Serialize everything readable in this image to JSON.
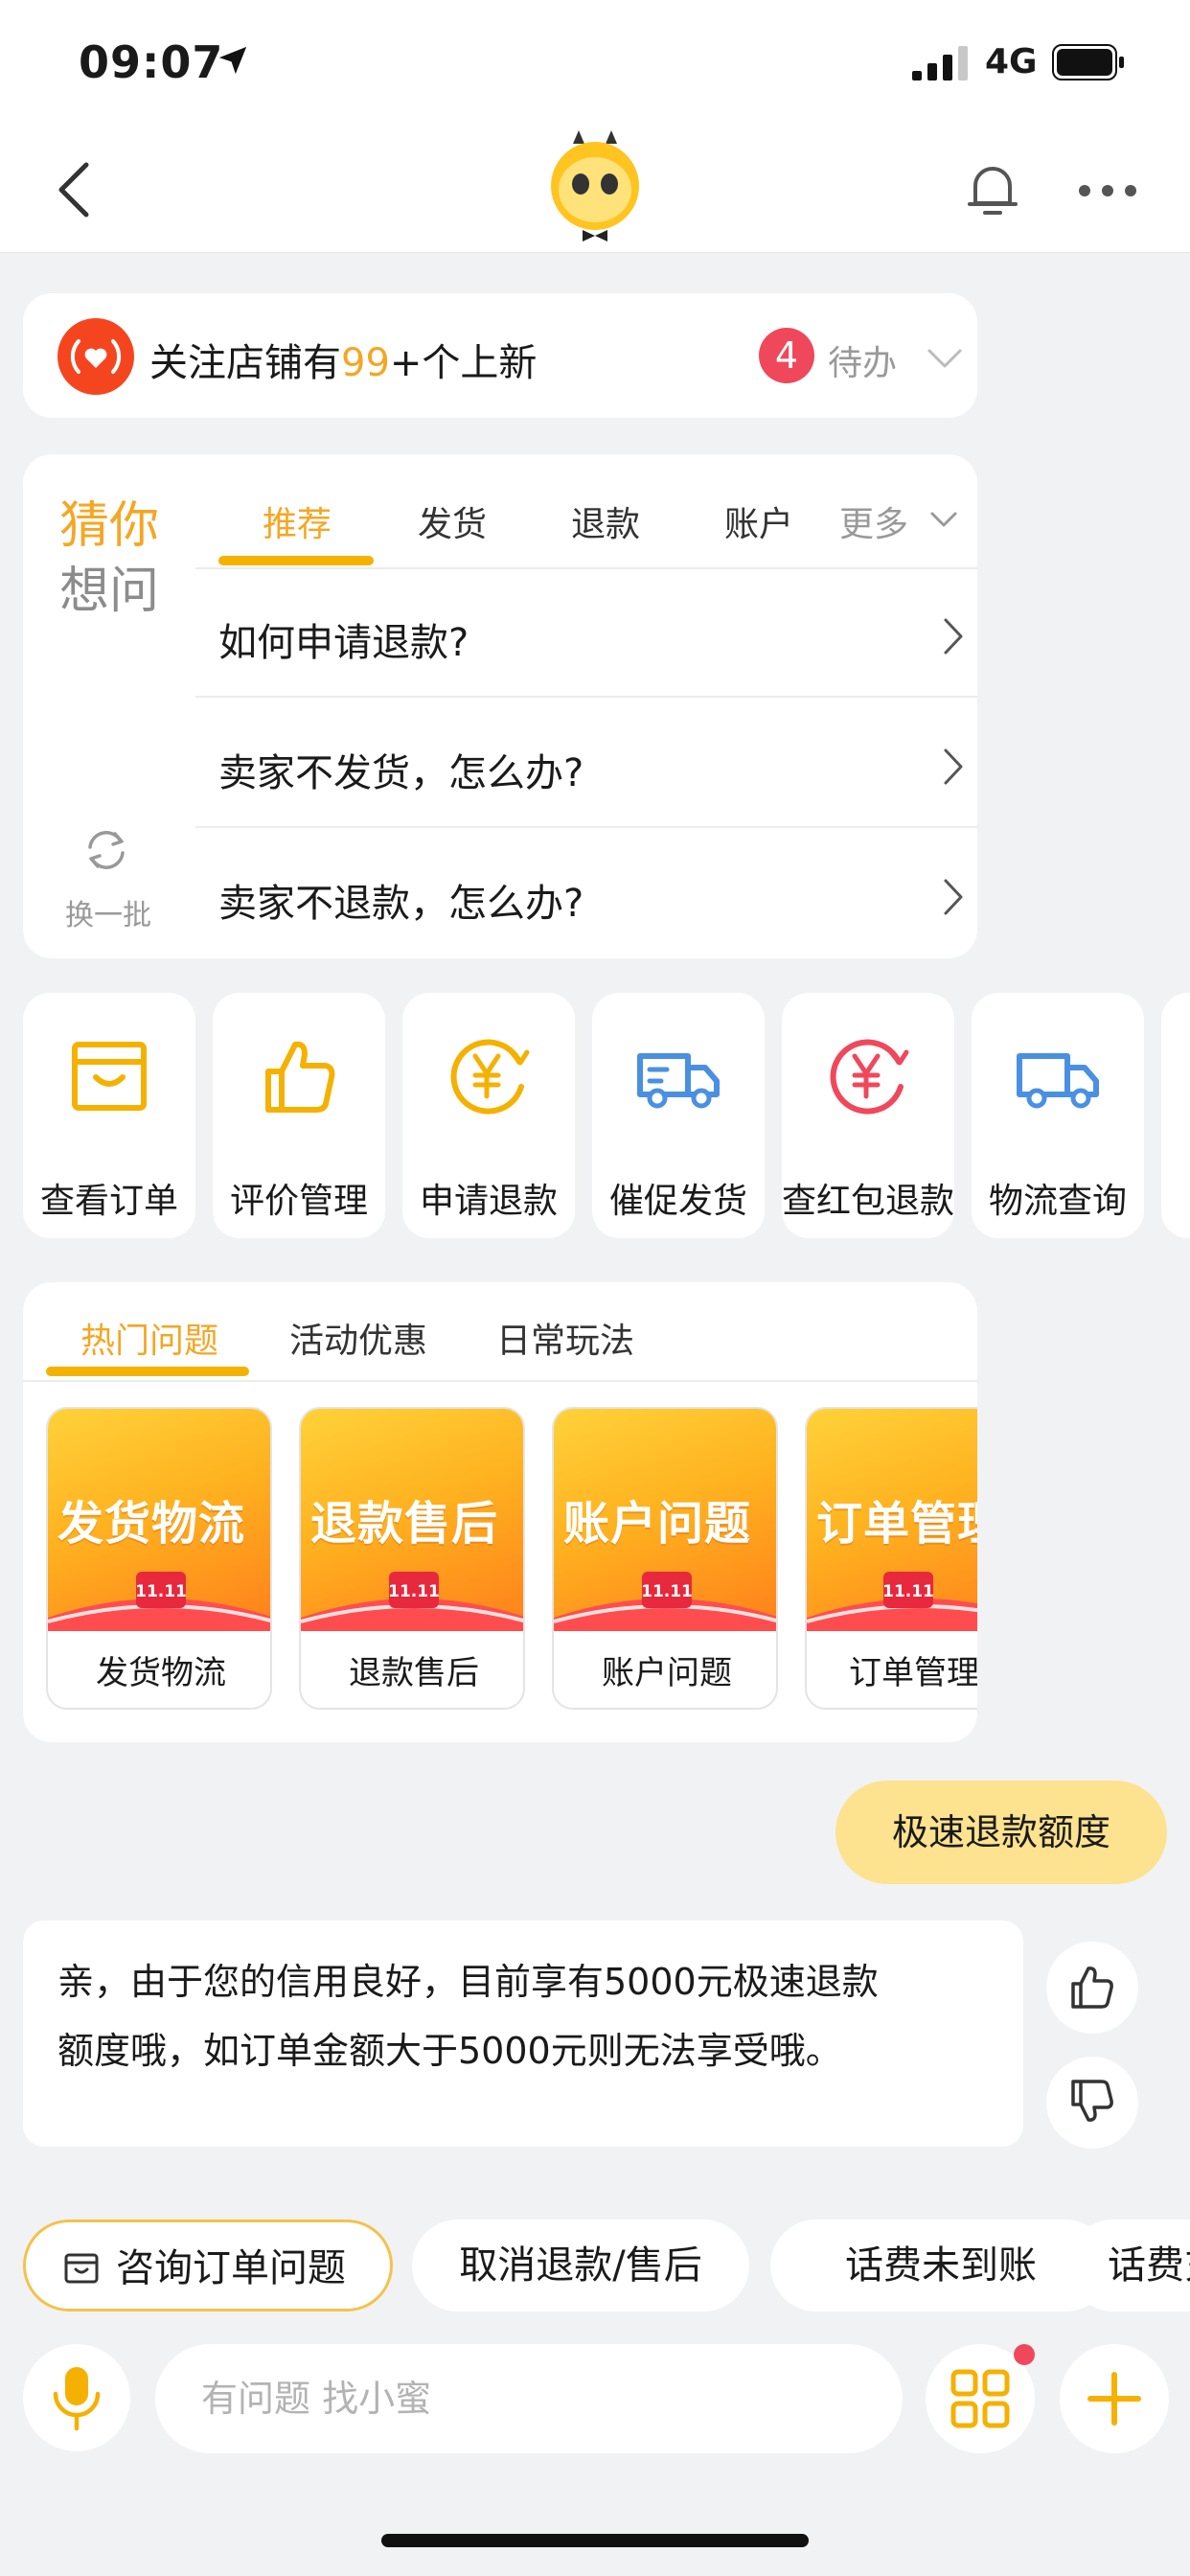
{
  "status_bar": {
    "time": "09:07",
    "network": "4G"
  },
  "follow": {
    "prefix": "关注店铺有",
    "count": "99",
    "suffix": "+个上新",
    "badge": "4",
    "todo": "待办"
  },
  "guess": {
    "title_1": "猜你",
    "title_2": "想问",
    "refresh": "换一批",
    "tabs": [
      "推荐",
      "发货",
      "退款",
      "账户",
      "更多"
    ],
    "questions": [
      "如何申请退款?",
      "卖家不发货，怎么办?",
      "卖家不退款，怎么办?"
    ]
  },
  "quick_actions": [
    {
      "label": "查看订单",
      "icon": "order-box-icon",
      "color": "#f5b100"
    },
    {
      "label": "评价管理",
      "icon": "thumbs-up-icon",
      "color": "#f5b100"
    },
    {
      "label": "申请退款",
      "icon": "yuan-refund-icon",
      "color": "#f5b100"
    },
    {
      "label": "催促发货",
      "icon": "delivery-truck-icon",
      "color": "#4a90e2"
    },
    {
      "label": "查红包退款",
      "icon": "yuan-redpacket-icon",
      "color": "#f0485b"
    },
    {
      "label": "物流查询",
      "icon": "logistics-truck-icon",
      "color": "#4a90e2"
    }
  ],
  "hot": {
    "tabs": [
      "热门问题",
      "活动优惠",
      "日常玩法"
    ],
    "tiles": [
      {
        "big": "发货物流",
        "badge": "11.11",
        "caption": "发货物流"
      },
      {
        "big": "退款售后",
        "badge": "11.11",
        "caption": "退款售后"
      },
      {
        "big": "账户问题",
        "badge": "11.11",
        "caption": "账户问题"
      },
      {
        "big": "订单管理",
        "badge": "11.11",
        "caption": "订单管理"
      }
    ]
  },
  "chat": {
    "user_message": "极速退款额度",
    "reply_line_1": "亲，由于您的信用良好，目前享有5000元极速退款",
    "reply_line_2": "额度哦，如订单金额大于5000元则无法享受哦。"
  },
  "chips": [
    "咨询订单问题",
    "取消退款/售后",
    "话费未到账",
    "话费充值"
  ],
  "input": {
    "placeholder": "有问题 找小蜜"
  },
  "colors": {
    "accent": "#f5b100",
    "badge_red": "#f0485b",
    "bubble": "#fde28f",
    "blue": "#4a90e2"
  }
}
